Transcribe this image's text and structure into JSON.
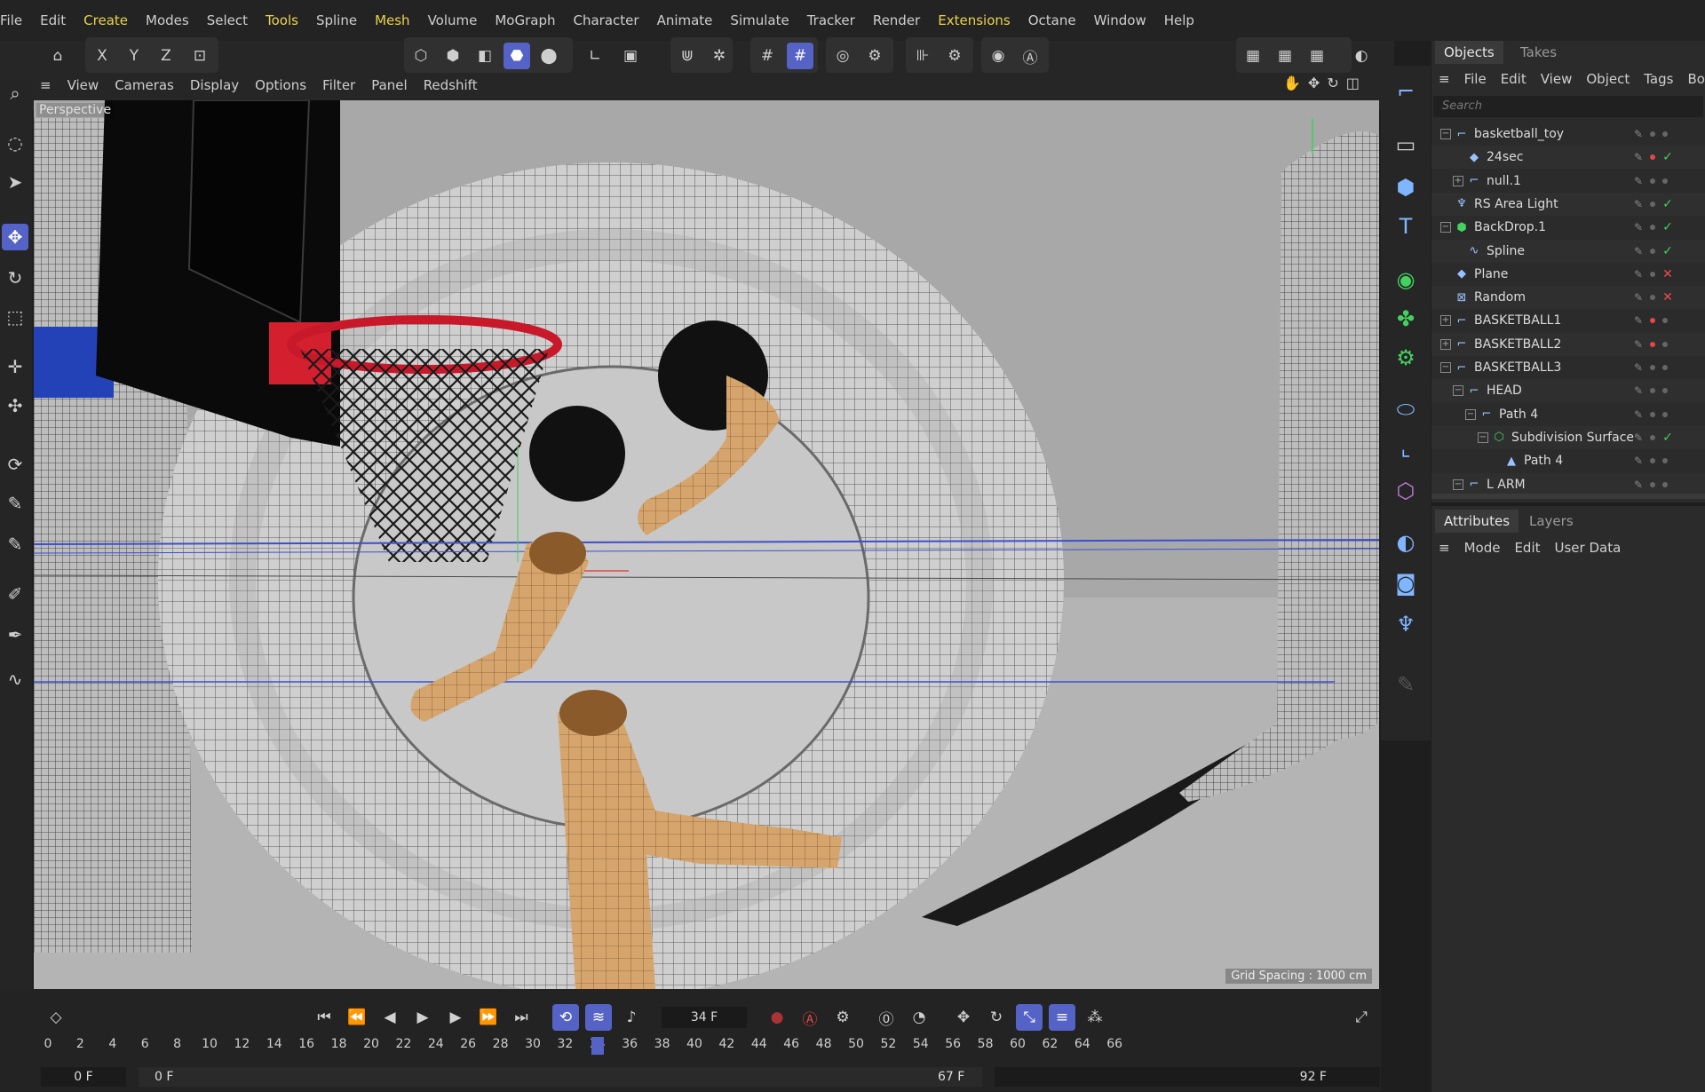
{
  "menubar": {
    "items": [
      "File",
      "Edit",
      "Create",
      "Modes",
      "Select",
      "Tools",
      "Spline",
      "Mesh",
      "Volume",
      "MoGraph",
      "Character",
      "Animate",
      "Simulate",
      "Tracker",
      "Render",
      "Extensions",
      "Octane",
      "Window",
      "Help"
    ],
    "highlighted": [
      "Create",
      "Tools",
      "Mesh",
      "Extensions"
    ]
  },
  "toolbar": {
    "axis_x": "X",
    "axis_y": "Y",
    "axis_z": "Z"
  },
  "viewport": {
    "menu": [
      "View",
      "Cameras",
      "Display",
      "Options",
      "Filter",
      "Panel",
      "Redshift"
    ],
    "camera_label": "Perspective",
    "grid_spacing": "Grid Spacing : 1000 cm"
  },
  "objects_panel": {
    "tabs": [
      "Objects",
      "Takes"
    ],
    "menu": [
      "File",
      "Edit",
      "View",
      "Object",
      "Tags",
      "Book"
    ],
    "search_placeholder": "Search",
    "rows": [
      {
        "name": "basketball_toy",
        "indent": 0,
        "exp": "−",
        "icon": "null-icon",
        "status": [
          "dot",
          "dot"
        ]
      },
      {
        "name": "24sec",
        "indent": 1,
        "exp": "",
        "icon": "camera-target-icon",
        "status": [
          "dot-red",
          "check"
        ]
      },
      {
        "name": "null.1",
        "indent": 1,
        "exp": "+",
        "icon": "null-icon",
        "status": [
          "dot",
          "dot"
        ]
      },
      {
        "name": "RS Area Light",
        "indent": 0,
        "exp": "",
        "icon": "light-icon",
        "status": [
          "dot",
          "check"
        ]
      },
      {
        "name": "BackDrop.1",
        "indent": 0,
        "exp": "−",
        "icon": "cube-icon",
        "status": [
          "dot",
          "check"
        ]
      },
      {
        "name": "Spline",
        "indent": 1,
        "exp": "",
        "icon": "spline-icon",
        "status": [
          "dot",
          "check"
        ]
      },
      {
        "name": "Plane",
        "indent": 0,
        "exp": "",
        "icon": "plane-icon",
        "status": [
          "dot",
          "cross"
        ]
      },
      {
        "name": "Random",
        "indent": 0,
        "exp": "",
        "icon": "effector-icon",
        "status": [
          "dot",
          "cross"
        ]
      },
      {
        "name": "BASKETBALL1",
        "indent": 0,
        "exp": "+",
        "icon": "null-icon",
        "status": [
          "dot-red",
          "dot"
        ]
      },
      {
        "name": "BASKETBALL2",
        "indent": 0,
        "exp": "+",
        "icon": "null-icon",
        "status": [
          "dot-red",
          "dot"
        ]
      },
      {
        "name": "BASKETBALL3",
        "indent": 0,
        "exp": "−",
        "icon": "null-icon",
        "status": [
          "dot",
          "dot"
        ]
      },
      {
        "name": "HEAD",
        "indent": 1,
        "exp": "−",
        "icon": "null-icon",
        "status": [
          "dot",
          "dot"
        ]
      },
      {
        "name": "Path 4",
        "indent": 2,
        "exp": "−",
        "icon": "null-icon",
        "status": [
          "dot",
          "dot"
        ]
      },
      {
        "name": "Subdivision Surface",
        "indent": 3,
        "exp": "−",
        "icon": "subdivision-icon",
        "status": [
          "dot",
          "check"
        ]
      },
      {
        "name": "Path 4",
        "indent": 4,
        "exp": "",
        "icon": "path-icon",
        "status": [
          "dot",
          "dot"
        ]
      },
      {
        "name": "L ARM",
        "indent": 1,
        "exp": "−",
        "icon": "null-icon",
        "status": [
          "dot",
          "dot"
        ]
      }
    ]
  },
  "attributes_panel": {
    "tabs": [
      "Attributes",
      "Layers"
    ],
    "menu": [
      "Mode",
      "Edit",
      "User Data"
    ]
  },
  "timeline": {
    "current_frame": "34 F",
    "ticks": [
      "0",
      "2",
      "4",
      "6",
      "8",
      "10",
      "12",
      "14",
      "16",
      "18",
      "20",
      "22",
      "24",
      "26",
      "28",
      "30",
      "32",
      "34",
      "36",
      "38",
      "40",
      "42",
      "44",
      "46",
      "48",
      "50",
      "52",
      "54",
      "56",
      "58",
      "60",
      "62",
      "64",
      "66"
    ],
    "range_start": "0 F",
    "range_start2": "0 F",
    "range_mid": "67 F",
    "range_end": "92 F",
    "playhead": 34
  },
  "colors": {
    "accent": "#5563c7",
    "check": "#3fd05a",
    "cross": "#f04b4b",
    "highlight_menu": "#e9d34a"
  }
}
